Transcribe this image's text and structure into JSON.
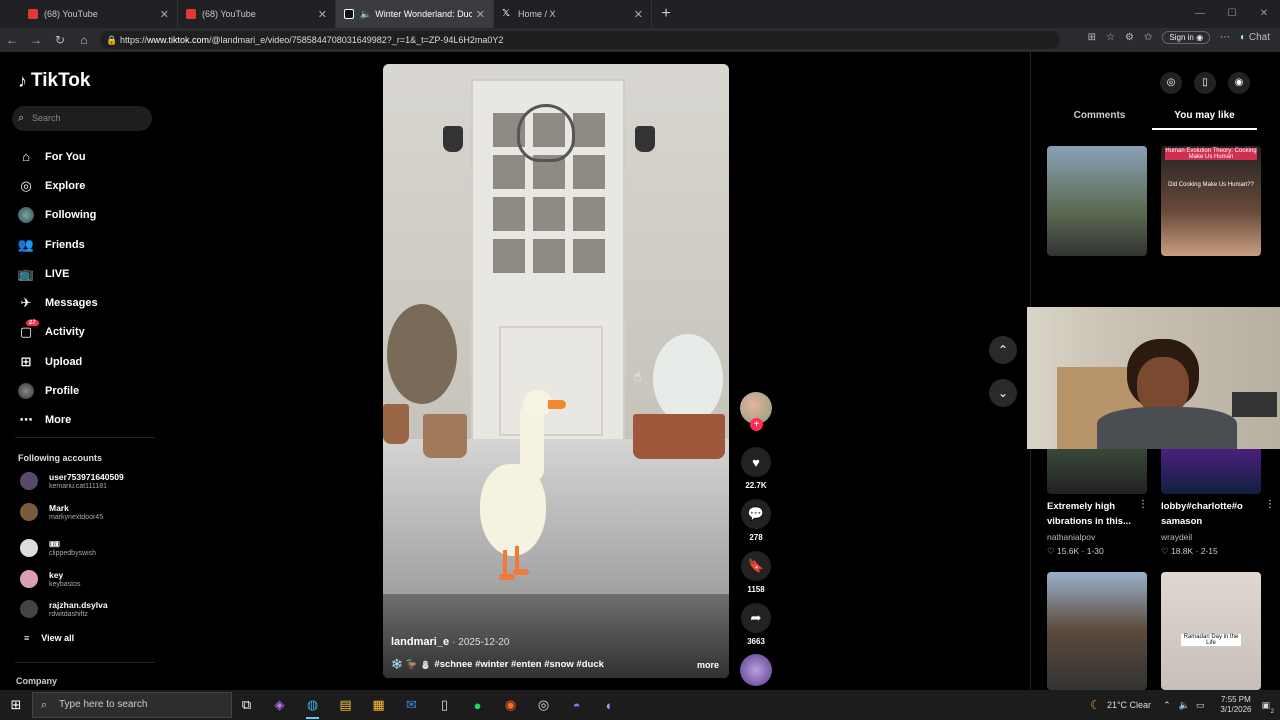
{
  "browser": {
    "tabs": [
      {
        "title": "(68) YouTube",
        "color": "#e53935"
      },
      {
        "title": "(68) YouTube",
        "color": "#e53935"
      },
      {
        "title": "Winter Wonderland: Ducks in",
        "color": "#ffffff"
      },
      {
        "title": "Home / X",
        "color": "#ffffff"
      }
    ],
    "url_prefix": "https://",
    "url_host": "www.tiktok.com",
    "url_path": "/@landmari_e/video/7585844708031649982?_r=1&_t=ZP-94L6H2ma0Y2",
    "signin_label": "Sign in",
    "chat_label": "Chat"
  },
  "tiktok": {
    "logo_text": "TikTok",
    "search_placeholder": "Search",
    "menu": [
      {
        "label": "For You",
        "icon": "home-icon"
      },
      {
        "label": "Explore",
        "icon": "compass-icon"
      },
      {
        "label": "Following",
        "icon": "following-icon"
      },
      {
        "label": "Friends",
        "icon": "friends-icon"
      },
      {
        "label": "LIVE",
        "icon": "live-icon"
      },
      {
        "label": "Messages",
        "icon": "messages-icon"
      },
      {
        "label": "Activity",
        "icon": "activity-icon",
        "badge": "27"
      },
      {
        "label": "Upload",
        "icon": "upload-icon"
      },
      {
        "label": "Profile",
        "icon": "profile-icon"
      },
      {
        "label": "More",
        "icon": "more-icon"
      }
    ],
    "following_title": "Following accounts",
    "following_accounts": [
      {
        "name": "user753971640509",
        "handle": "kemariu.cat111181"
      },
      {
        "name": "Mark",
        "handle": "markynextdoor45"
      },
      {
        "name": "🎟",
        "handle": "clippedbyswish"
      },
      {
        "name": "key",
        "handle": "keybastos"
      },
      {
        "name": "rajzhan.dsylva",
        "handle": "rdwitdashiftz"
      }
    ],
    "view_all": "View all",
    "company_label": "Company"
  },
  "video": {
    "username": "landmari_e",
    "date": "2025-12-20",
    "hashtags": "❄️ 🦆 ⛄ #schnee #winter #enten #snow #duck",
    "more_label": "more",
    "likes": "22.7K",
    "comments": "278",
    "saves": "1158",
    "shares": "3663"
  },
  "right_panel": {
    "tab_comments": "Comments",
    "tab_you_may_like": "You may like",
    "cards": [
      {
        "title": "",
        "user": "",
        "meta": "",
        "thumb_text": ""
      },
      {
        "title": "",
        "user": "",
        "meta": "",
        "thumb_text": "Human Evolution Theory: Cooking Make Us Human"
      },
      {
        "title": "Extremely high vibrations in this...",
        "user": "nathanialpov",
        "meta": "♡ 15.6K · 1-30",
        "thumb_text": ""
      },
      {
        "title": "lobby#charlotte#o samason",
        "user": "wraydeil",
        "meta": "♡ 18.8K · 2-15",
        "thumb_text": ""
      },
      {
        "title": "",
        "user": "",
        "meta": "",
        "thumb_text": ""
      },
      {
        "title": "",
        "user": "",
        "meta": "",
        "thumb_text": "Ramadan Day in the Life"
      }
    ],
    "thumb2_sub": "Did Cooking Make Us Human??"
  },
  "taskbar": {
    "search_placeholder": "Type here to search",
    "weather": "21°C  Clear",
    "time": "7:55 PM",
    "date": "3/1/2026",
    "notif_count": "2"
  },
  "colors": {
    "accent": "#fe2c55",
    "bg": "#000000"
  }
}
